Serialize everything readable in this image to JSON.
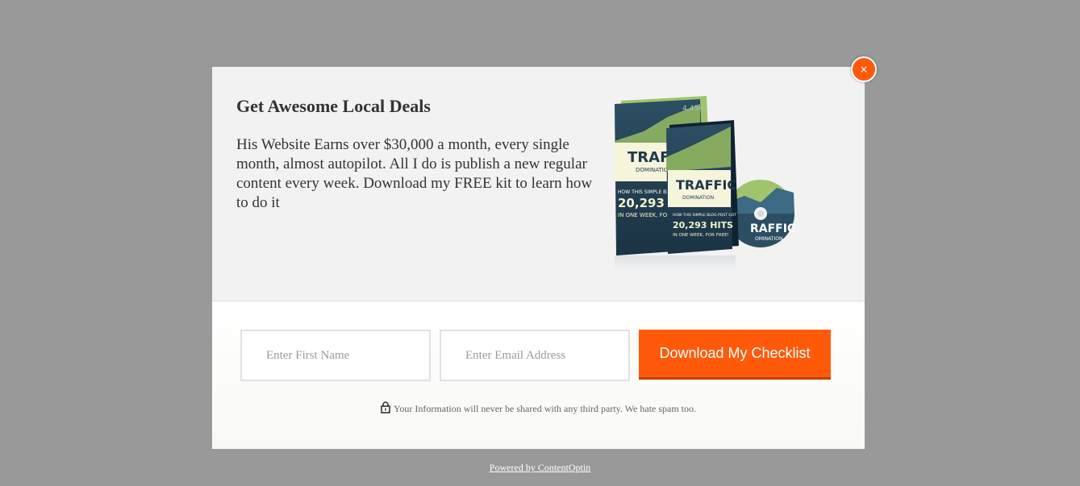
{
  "popup": {
    "headline": "Get Awesome Local Deals",
    "body": "His Website Earns over $30,000 a month, every single month, almost autopilot. All I do is publish a new regular content every week. Download my FREE kit to learn how to do it",
    "close_label": "×",
    "product": {
      "box_title": "TRAFFIC",
      "box_subtitle": "DOMINATION",
      "box_tagline": "HOW THIS SIMPLE BLOG POST GOT",
      "box_hits": "20,293 HITS",
      "box_tagline2": "IN ONE WEEK, FOR FREE!",
      "back_tagline": "HOW THIS SIMPLE BLOG",
      "back_hits": "20,293",
      "back_tagline2": "IN ONE WEEK, FO",
      "back_corner": "4,454",
      "disc_title": "RAFFIC",
      "disc_subtitle": "OMINATION"
    }
  },
  "form": {
    "first_name_placeholder": "Enter First Name",
    "email_placeholder": "Enter Email Address",
    "submit_label": "Download My Checklist",
    "privacy_text": "Your Information will never be shared with any third party. We hate spam too."
  },
  "footer": {
    "powered_by": "Powered by ContentOptin"
  },
  "colors": {
    "overlay": "#999999",
    "accent": "#ff5a0a",
    "top_panel": "#f2f2f2"
  }
}
